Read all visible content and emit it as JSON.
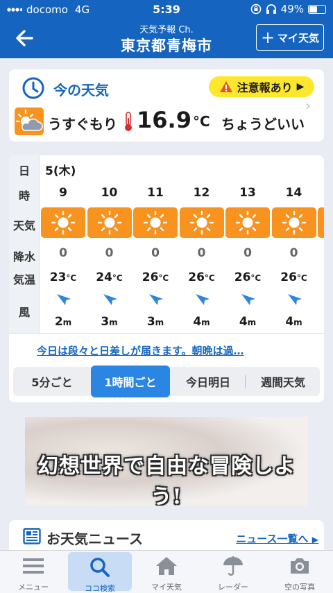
{
  "status_bar": {
    "carrier": "docomo",
    "network": "4G",
    "time": "5:39",
    "battery": "49%",
    "battery_level": 0.49
  },
  "header": {
    "subtitle": "天気予報 Ch.",
    "title": "東京都青梅市",
    "add_button": "マイ天気"
  },
  "now": {
    "title": "今の天気",
    "alert": "注意報あり",
    "condition": "うすぐもり",
    "temperature": "16.9",
    "unit": "°C",
    "feel": "ちょうどいい"
  },
  "hourly": {
    "labels": {
      "day": "日",
      "hour": "時",
      "weather": "天気",
      "precip": "降水",
      "temp": "気温",
      "wind": "風"
    },
    "day": "5(木)",
    "hours": [
      {
        "hour": "9",
        "precip": "0",
        "temp": "23",
        "wind": "2"
      },
      {
        "hour": "10",
        "precip": "0",
        "temp": "24",
        "wind": "3"
      },
      {
        "hour": "11",
        "precip": "0",
        "temp": "26",
        "wind": "3"
      },
      {
        "hour": "12",
        "precip": "0",
        "temp": "26",
        "wind": "4"
      },
      {
        "hour": "13",
        "precip": "0",
        "temp": "26",
        "wind": "4"
      },
      {
        "hour": "14",
        "precip": "0",
        "temp": "26",
        "wind": "4"
      }
    ],
    "temp_unit": "°C",
    "wind_unit": "m",
    "forecast_text": "今日は段々と日差しが届きます。朝晩は過…",
    "tabs": [
      "5分ごと",
      "1時間ごと",
      "今日明日",
      "週間天気"
    ],
    "active_tab": "1時間ごと"
  },
  "ad": {
    "text": "幻想世界で自由な冒険しよう!"
  },
  "news": {
    "title": "お天気ニュース",
    "link": "ニュース一覧へ"
  },
  "bottom_nav": [
    {
      "label": "メニュー",
      "icon": "menu-icon"
    },
    {
      "label": "ココ検索",
      "icon": "search-icon"
    },
    {
      "label": "マイ天気",
      "icon": "home-icon"
    },
    {
      "label": "レーダー",
      "icon": "umbrella-icon"
    },
    {
      "label": "空の写真",
      "icon": "camera-icon"
    }
  ],
  "colors": {
    "brand": "#1565c0",
    "sunny_tile": "#f7931e",
    "alert": "#fde72c",
    "active_tab": "#2b86e3"
  }
}
